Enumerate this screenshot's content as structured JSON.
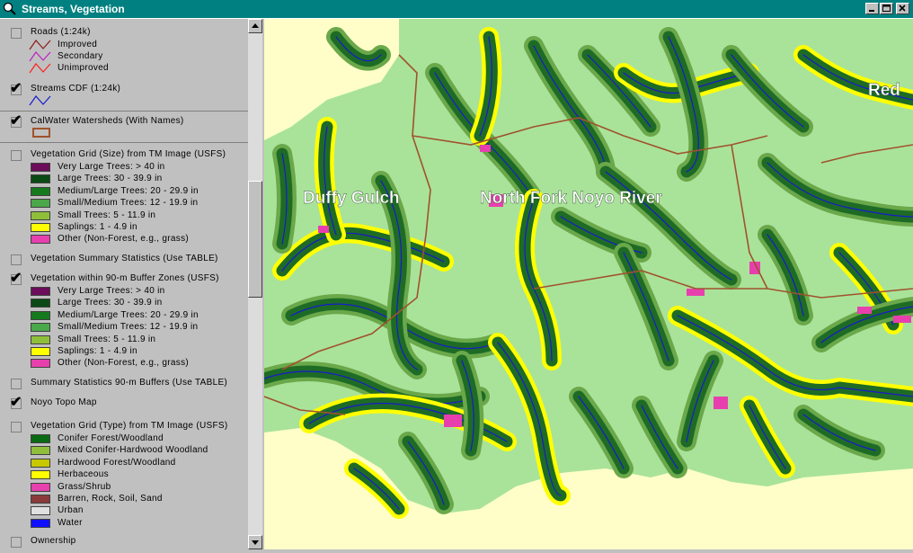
{
  "window": {
    "title": "Streams, Vegetation"
  },
  "layers": {
    "roads": {
      "title": "Roads (1:24k)",
      "checked": false,
      "items": [
        {
          "label": "Improved",
          "color": "#8b1a1a"
        },
        {
          "label": "Secondary",
          "color": "#c020c0"
        },
        {
          "label": "Unimproved",
          "color": "#ff2020"
        }
      ]
    },
    "streams": {
      "title": "Streams CDF (1:24k)",
      "checked": true,
      "color": "#1a1acc"
    },
    "watersheds": {
      "title": "CalWater Watersheds (With Names)",
      "checked": true,
      "color": "#a0522d"
    },
    "veg_size": {
      "title": "Vegetation Grid (Size) from TM Image (USFS)",
      "checked": false,
      "items": [
        {
          "label": "Very Large Trees: > 40  in",
          "color": "#6b0d5a"
        },
        {
          "label": "Large Trees: 30 - 39.9 in",
          "color": "#0b4a14"
        },
        {
          "label": "Medium/Large Trees: 20 - 29.9 in",
          "color": "#157a1e"
        },
        {
          "label": "Small/Medium Trees: 12 - 19.9 in",
          "color": "#4aa84a"
        },
        {
          "label": "Small Trees: 5 - 11.9 in",
          "color": "#8fbf3a"
        },
        {
          "label": "Saplings: 1 - 4.9 in",
          "color": "#ffff00"
        },
        {
          "label": "Other (Non-Forest, e.g., grass)",
          "color": "#e83fae"
        }
      ]
    },
    "veg_summary": {
      "title": "Vegetation Summary Statistics (Use TABLE)",
      "checked": false
    },
    "veg_buffer": {
      "title": "Vegetation within 90-m Buffer Zones (USFS)",
      "checked": true,
      "items": [
        {
          "label": "Very Large Trees: > 40  in",
          "color": "#6b0d5a"
        },
        {
          "label": "Large Trees: 30 - 39.9 in",
          "color": "#0b4a14"
        },
        {
          "label": "Medium/Large Trees: 20 - 29.9 in",
          "color": "#157a1e"
        },
        {
          "label": "Small/Medium Trees: 12 - 19.9 in",
          "color": "#4aa84a"
        },
        {
          "label": "Small Trees: 5 - 11.9 in",
          "color": "#8fbf3a"
        },
        {
          "label": "Saplings: 1 - 4.9 in",
          "color": "#ffff00"
        },
        {
          "label": "Other (Non-Forest, e.g., grass)",
          "color": "#e83fae"
        }
      ]
    },
    "buffer_summary": {
      "title": "Summary Statistics 90-m Buffers (Use TABLE)",
      "checked": false
    },
    "topo": {
      "title": "Noyo Topo Map",
      "checked": true
    },
    "veg_type": {
      "title": "Vegetation Grid (Type) from TM Image (USFS)",
      "checked": false,
      "items": [
        {
          "label": "Conifer Forest/Woodland",
          "color": "#0b6a14"
        },
        {
          "label": "Mixed Conifer-Hardwood Woodland",
          "color": "#8fbf3a"
        },
        {
          "label": "Hardwood Forest/Woodland",
          "color": "#c8c800"
        },
        {
          "label": "Herbaceous",
          "color": "#ffff00"
        },
        {
          "label": "Grass/Shrub",
          "color": "#e83fae"
        },
        {
          "label": "Barren, Rock, Soil, Sand",
          "color": "#8b3a3a"
        },
        {
          "label": "Urban",
          "color": "#e0e0e0"
        },
        {
          "label": "Water",
          "color": "#1010ff"
        }
      ]
    },
    "ownership": {
      "title": "Ownership",
      "checked": false
    }
  },
  "map": {
    "labels": [
      "Duffy Gulch",
      "North Fork Noyo River",
      "Red"
    ],
    "colors": {
      "land": "#a9e39a",
      "ocean": "#fffec8",
      "conifer": "#1d6b25",
      "sapling": "#ffff00",
      "other": "#e83fae",
      "stream": "#1a1acc",
      "watershed": "#a0522d",
      "mixed": "#6aa84a"
    }
  }
}
